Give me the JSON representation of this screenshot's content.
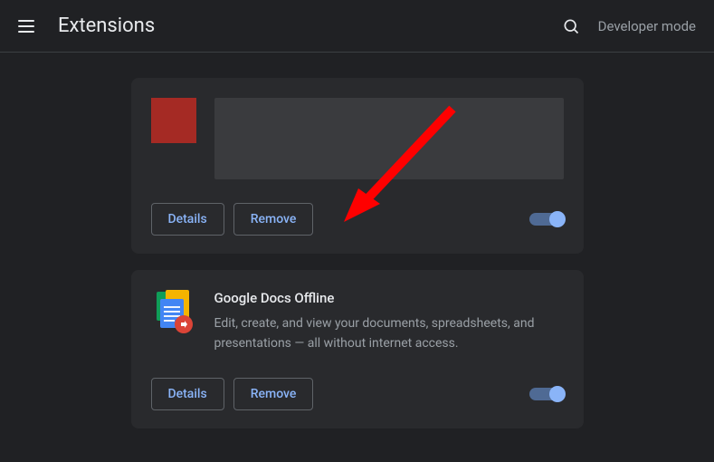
{
  "header": {
    "title": "Extensions",
    "dev_mode": "Developer mode"
  },
  "extensions": [
    {
      "title": "",
      "desc": "",
      "details_label": "Details",
      "remove_label": "Remove"
    },
    {
      "title": "Google Docs Offline",
      "desc": "Edit, create, and view your documents, spreadsheets, and presentations — all without internet access.",
      "details_label": "Details",
      "remove_label": "Remove"
    }
  ]
}
